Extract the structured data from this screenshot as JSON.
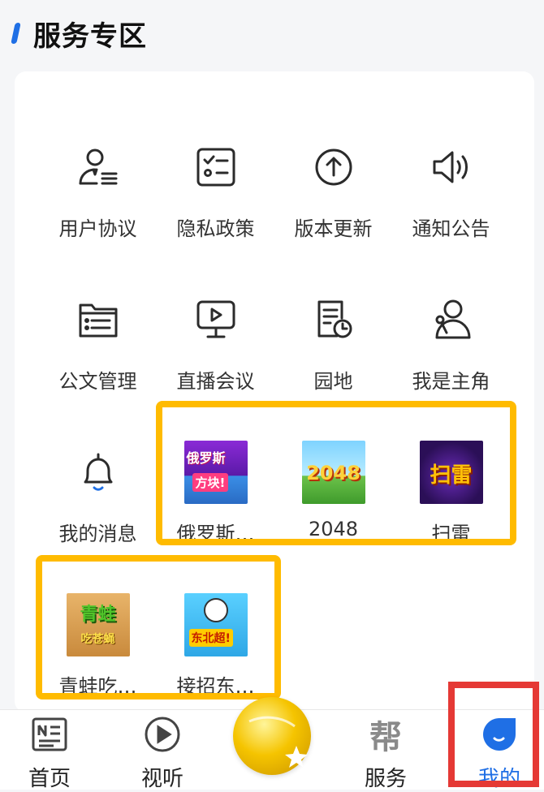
{
  "section": {
    "title": "服务专区",
    "accent_color": "#1f6fe5"
  },
  "services": [
    {
      "label": "用户协议",
      "icon": "user-agreement-icon"
    },
    {
      "label": "隐私政策",
      "icon": "privacy-checklist-icon"
    },
    {
      "label": "版本更新",
      "icon": "upload-arrow-icon"
    },
    {
      "label": "通知公告",
      "icon": "speaker-icon"
    },
    {
      "label": "公文管理",
      "icon": "folder-list-icon"
    },
    {
      "label": "直播会议",
      "icon": "live-monitor-icon"
    },
    {
      "label": "园地",
      "icon": "document-clock-icon"
    },
    {
      "label": "我是主角",
      "icon": "person-microphone-icon"
    },
    {
      "label": "我的消息",
      "icon": "bell-icon"
    }
  ],
  "games": [
    {
      "label": "俄罗斯…",
      "art": "俄罗斯 方块!",
      "icon": "tetris-game-icon"
    },
    {
      "label": "2048",
      "art": "2048",
      "icon": "2048-game-icon"
    },
    {
      "label": "扫雷",
      "art": "扫雷",
      "icon": "minesweeper-game-icon"
    },
    {
      "label": "青蛙吃…",
      "art": "青蛙 吃苍蝇",
      "icon": "frog-game-icon"
    },
    {
      "label": "接招东…",
      "art": "接招 东北超!",
      "icon": "soccer-game-icon"
    }
  ],
  "nav": [
    {
      "label": "首页",
      "icon": "news-icon"
    },
    {
      "label": "视听",
      "icon": "play-circle-icon"
    },
    {
      "label": "",
      "icon": "star-logo-icon"
    },
    {
      "label": "服务",
      "icon": "bang-logo-icon"
    },
    {
      "label": "我的",
      "icon": "profile-drop-icon",
      "active": true
    }
  ],
  "colors": {
    "highlight_yellow": "#ffbb00",
    "highlight_red": "#e53935",
    "active_blue": "#1f6fe5"
  }
}
